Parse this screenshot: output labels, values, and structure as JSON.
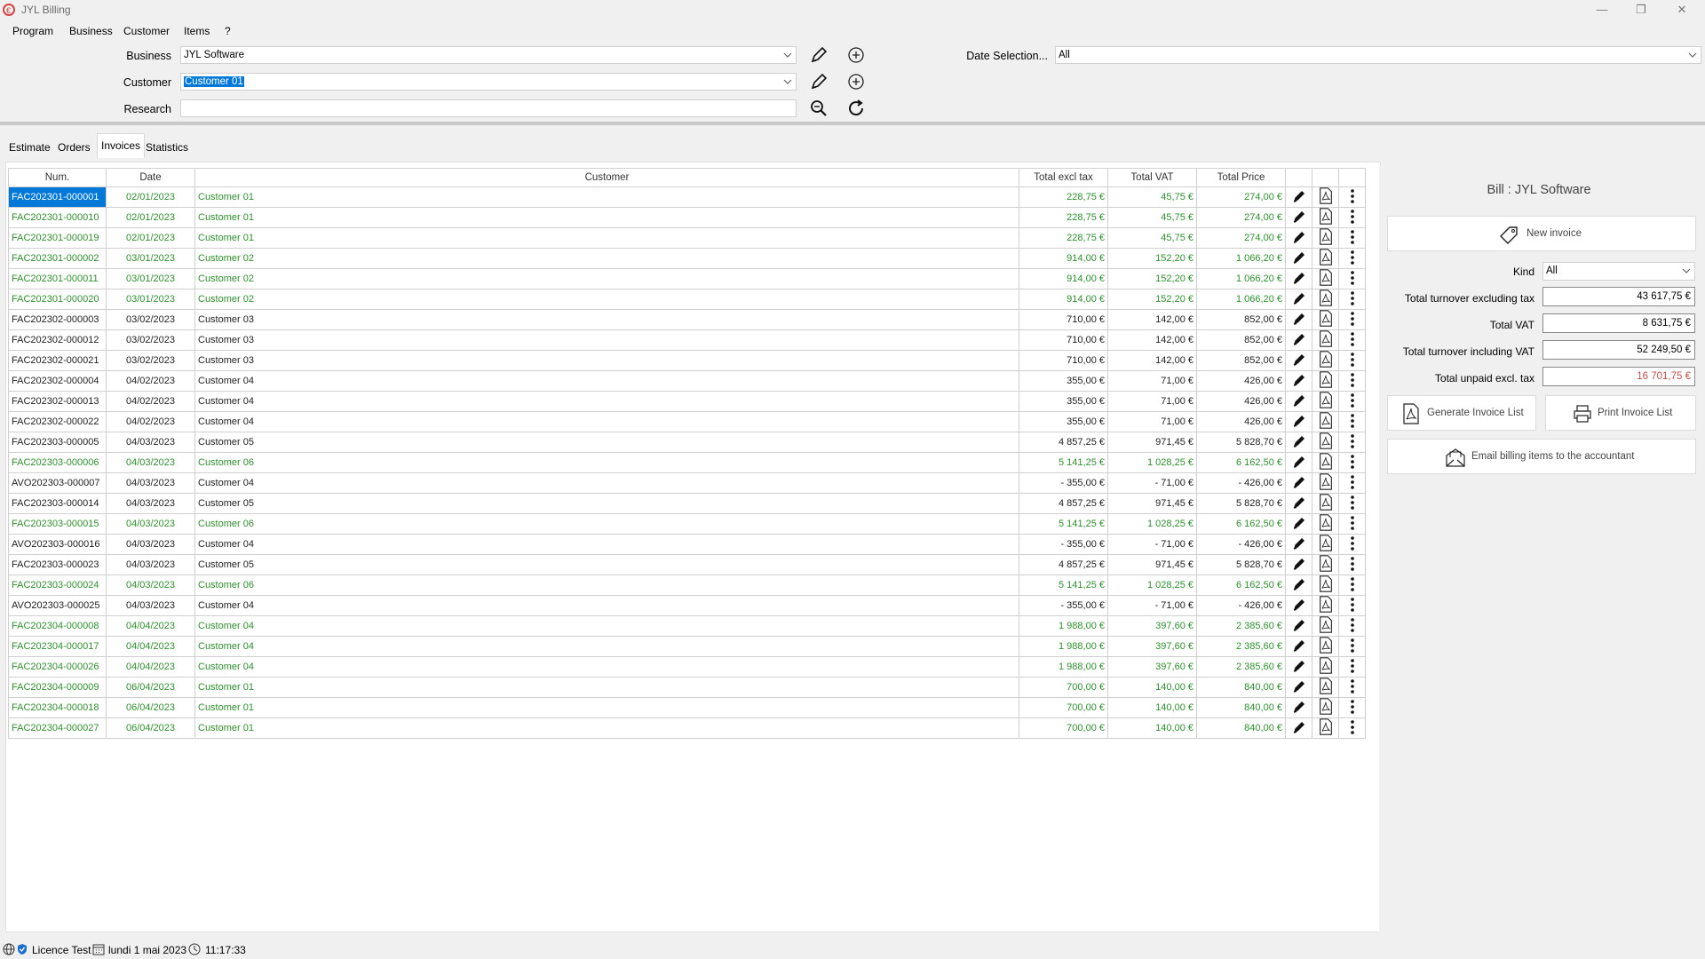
{
  "app": {
    "title": "JYL Billing"
  },
  "menu": [
    "Program",
    "Business",
    "Customer",
    "Items",
    "?"
  ],
  "filters": {
    "business_label": "Business",
    "business_value": "JYL Software",
    "customer_label": "Customer",
    "customer_value": "Customer 01",
    "research_label": "Research",
    "research_value": "",
    "date_label": "Date Selection...",
    "date_value": "All"
  },
  "tabs": [
    "Estimate",
    "Orders",
    "Invoices",
    "Statistics"
  ],
  "active_tab": "Invoices",
  "table": {
    "columns": [
      "Num.",
      "Date",
      "Customer",
      "Total excl tax",
      "Total VAT",
      "Total Price"
    ],
    "rows": [
      {
        "num": "FAC202301-000001",
        "date": "02/01/2023",
        "customer": "Customer 01",
        "excl": "228,75 €",
        "vat": "45,75 €",
        "price": "274,00 €",
        "style": "green"
      },
      {
        "num": "FAC202301-000010",
        "date": "02/01/2023",
        "customer": "Customer 01",
        "excl": "228,75 €",
        "vat": "45,75 €",
        "price": "274,00 €",
        "style": "green"
      },
      {
        "num": "FAC202301-000019",
        "date": "02/01/2023",
        "customer": "Customer 01",
        "excl": "228,75 €",
        "vat": "45,75 €",
        "price": "274,00 €",
        "style": "green"
      },
      {
        "num": "FAC202301-000002",
        "date": "03/01/2023",
        "customer": "Customer 02",
        "excl": "914,00 €",
        "vat": "152,20 €",
        "price": "1 066,20 €",
        "style": "green"
      },
      {
        "num": "FAC202301-000011",
        "date": "03/01/2023",
        "customer": "Customer 02",
        "excl": "914,00 €",
        "vat": "152,20 €",
        "price": "1 066,20 €",
        "style": "green"
      },
      {
        "num": "FAC202301-000020",
        "date": "03/01/2023",
        "customer": "Customer 02",
        "excl": "914,00 €",
        "vat": "152,20 €",
        "price": "1 066,20 €",
        "style": "green"
      },
      {
        "num": "FAC202302-000003",
        "date": "03/02/2023",
        "customer": "Customer 03",
        "excl": "710,00 €",
        "vat": "142,00 €",
        "price": "852,00 €",
        "style": "normal"
      },
      {
        "num": "FAC202302-000012",
        "date": "03/02/2023",
        "customer": "Customer 03",
        "excl": "710,00 €",
        "vat": "142,00 €",
        "price": "852,00 €",
        "style": "normal"
      },
      {
        "num": "FAC202302-000021",
        "date": "03/02/2023",
        "customer": "Customer 03",
        "excl": "710,00 €",
        "vat": "142,00 €",
        "price": "852,00 €",
        "style": "normal"
      },
      {
        "num": "FAC202302-000004",
        "date": "04/02/2023",
        "customer": "Customer 04",
        "excl": "355,00 €",
        "vat": "71,00 €",
        "price": "426,00 €",
        "style": "normal"
      },
      {
        "num": "FAC202302-000013",
        "date": "04/02/2023",
        "customer": "Customer 04",
        "excl": "355,00 €",
        "vat": "71,00 €",
        "price": "426,00 €",
        "style": "normal"
      },
      {
        "num": "FAC202302-000022",
        "date": "04/02/2023",
        "customer": "Customer 04",
        "excl": "355,00 €",
        "vat": "71,00 €",
        "price": "426,00 €",
        "style": "normal"
      },
      {
        "num": "FAC202303-000005",
        "date": "04/03/2023",
        "customer": "Customer 05",
        "excl": "4 857,25 €",
        "vat": "971,45 €",
        "price": "5 828,70 €",
        "style": "normal"
      },
      {
        "num": "FAC202303-000006",
        "date": "04/03/2023",
        "customer": "Customer 06",
        "excl": "5 141,25 €",
        "vat": "1 028,25 €",
        "price": "6 162,50 €",
        "style": "green"
      },
      {
        "num": "AVO202303-000007",
        "date": "04/03/2023",
        "customer": "Customer 04",
        "excl": "-   355,00 €",
        "vat": "-   71,00 €",
        "price": "-   426,00 €",
        "style": "normal"
      },
      {
        "num": "FAC202303-000014",
        "date": "04/03/2023",
        "customer": "Customer 05",
        "excl": "4 857,25 €",
        "vat": "971,45 €",
        "price": "5 828,70 €",
        "style": "normal"
      },
      {
        "num": "FAC202303-000015",
        "date": "04/03/2023",
        "customer": "Customer 06",
        "excl": "5 141,25 €",
        "vat": "1 028,25 €",
        "price": "6 162,50 €",
        "style": "green"
      },
      {
        "num": "AVO202303-000016",
        "date": "04/03/2023",
        "customer": "Customer 04",
        "excl": "-   355,00 €",
        "vat": "-   71,00 €",
        "price": "-   426,00 €",
        "style": "normal"
      },
      {
        "num": "FAC202303-000023",
        "date": "04/03/2023",
        "customer": "Customer 05",
        "excl": "4 857,25 €",
        "vat": "971,45 €",
        "price": "5 828,70 €",
        "style": "normal"
      },
      {
        "num": "FAC202303-000024",
        "date": "04/03/2023",
        "customer": "Customer 06",
        "excl": "5 141,25 €",
        "vat": "1 028,25 €",
        "price": "6 162,50 €",
        "style": "green"
      },
      {
        "num": "AVO202303-000025",
        "date": "04/03/2023",
        "customer": "Customer 04",
        "excl": "-   355,00 €",
        "vat": "-   71,00 €",
        "price": "-   426,00 €",
        "style": "normal"
      },
      {
        "num": "FAC202304-000008",
        "date": "04/04/2023",
        "customer": "Customer 04",
        "excl": "1 988,00 €",
        "vat": "397,60 €",
        "price": "2 385,60 €",
        "style": "green"
      },
      {
        "num": "FAC202304-000017",
        "date": "04/04/2023",
        "customer": "Customer 04",
        "excl": "1 988,00 €",
        "vat": "397,60 €",
        "price": "2 385,60 €",
        "style": "green"
      },
      {
        "num": "FAC202304-000026",
        "date": "04/04/2023",
        "customer": "Customer 04",
        "excl": "1 988,00 €",
        "vat": "397,60 €",
        "price": "2 385,60 €",
        "style": "green"
      },
      {
        "num": "FAC202304-000009",
        "date": "06/04/2023",
        "customer": "Customer 01",
        "excl": "700,00 €",
        "vat": "140,00 €",
        "price": "840,00 €",
        "style": "green"
      },
      {
        "num": "FAC202304-000018",
        "date": "06/04/2023",
        "customer": "Customer 01",
        "excl": "700,00 €",
        "vat": "140,00 €",
        "price": "840,00 €",
        "style": "green"
      },
      {
        "num": "FAC202304-000027",
        "date": "06/04/2023",
        "customer": "Customer 01",
        "excl": "700,00 €",
        "vat": "140,00 €",
        "price": "840,00 €",
        "style": "green"
      }
    ]
  },
  "panel": {
    "title": "Bill : JYL Software",
    "new_invoice": "New invoice",
    "kind_label": "Kind",
    "kind_value": "All",
    "turnover_excl_label": "Total turnover excluding tax",
    "turnover_excl_value": "43 617,75 €",
    "vat_label": "Total VAT",
    "vat_value": "8 631,75 €",
    "turnover_incl_label": "Total turnover including VAT",
    "turnover_incl_value": "52 249,50 €",
    "unpaid_label": "Total unpaid excl. tax",
    "unpaid_value": "16 701,75 €",
    "generate_list": "Generate Invoice List",
    "print_list": "Print Invoice List",
    "email_accountant": "Email billing items to the accountant"
  },
  "status": {
    "licence": "Licence Test",
    "date": "lundi 1 mai 2023",
    "time": "11:17:33"
  },
  "colors": {
    "accent": "#0078d7",
    "paid_green": "#2f8f2f",
    "unpaid_red": "#c0504d"
  }
}
